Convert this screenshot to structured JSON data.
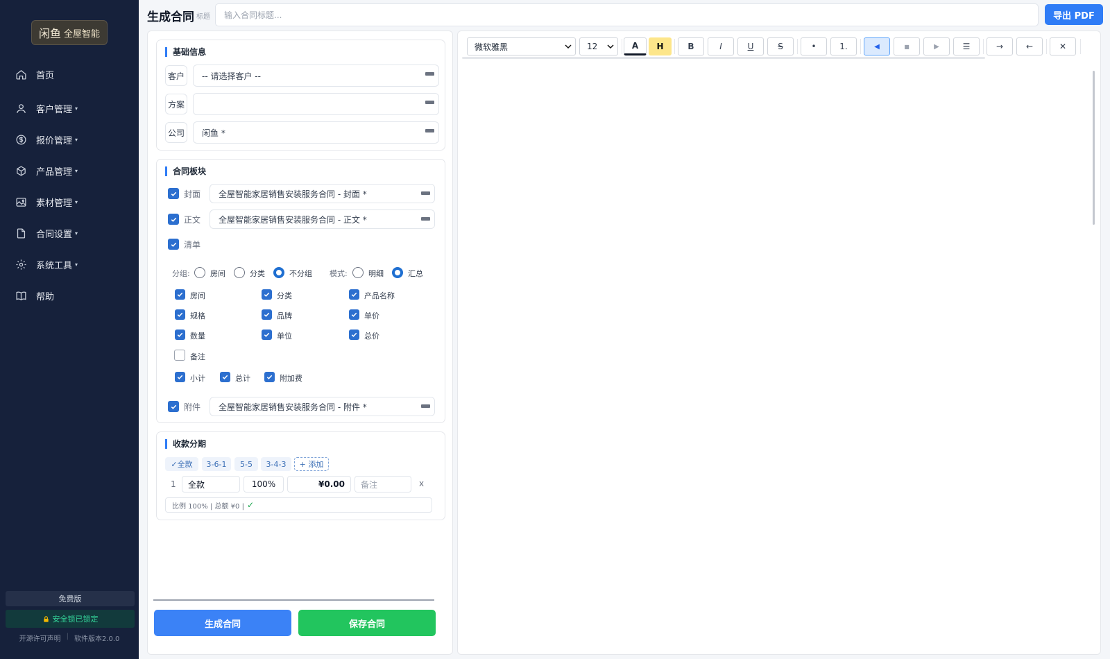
{
  "brand": {
    "seal": "闲鱼",
    "name": "全屋智能"
  },
  "nav": [
    {
      "label": "首页",
      "icon": "home-icon",
      "caret": false
    },
    {
      "label": "客户管理",
      "icon": "user-icon",
      "caret": true
    },
    {
      "label": "报价管理",
      "icon": "dollar-icon",
      "caret": true
    },
    {
      "label": "产品管理",
      "icon": "box-icon",
      "caret": true
    },
    {
      "label": "素材管理",
      "icon": "image-icon",
      "caret": true
    },
    {
      "label": "合同设置",
      "icon": "file-icon",
      "caret": true
    },
    {
      "label": "系统工具",
      "icon": "gear-icon",
      "caret": true
    },
    {
      "label": "帮助",
      "icon": "book-icon",
      "caret": false
    }
  ],
  "caret_glyph": "▾",
  "sidebar_footer": {
    "edition": "免费版",
    "lock_status": "安全锁已锁定",
    "license": "开源许可声明",
    "version": "软件版本2.0.0"
  },
  "header": {
    "title": "生成合同",
    "title_hint": "标题",
    "title_placeholder": "输入合同标题...",
    "export_label": "导出 PDF"
  },
  "basic": {
    "heading": "基础信息",
    "customer": {
      "label": "客户",
      "value": "-- 请选择客户 --"
    },
    "plan": {
      "label": "方案",
      "value": ""
    },
    "company": {
      "label": "公司",
      "value": "闲鱼 *"
    }
  },
  "blocks": {
    "heading": "合同板块",
    "cover": {
      "label": "封面",
      "checked": true,
      "value": "全屋智能家居销售安装服务合同 - 封面 *"
    },
    "body": {
      "label": "正文",
      "checked": true,
      "value": "全屋智能家居销售安装服务合同 - 正文 *"
    },
    "list": {
      "label": "清单",
      "checked": true
    },
    "group_label": "分组:",
    "group_options": [
      {
        "label": "房间",
        "selected": false
      },
      {
        "label": "分类",
        "selected": false
      },
      {
        "label": "不分组",
        "selected": true
      }
    ],
    "mode_label": "模式:",
    "mode_options": [
      {
        "label": "明细",
        "selected": false
      },
      {
        "label": "汇总",
        "selected": true
      }
    ],
    "columns": [
      {
        "label": "房间",
        "checked": true
      },
      {
        "label": "分类",
        "checked": true
      },
      {
        "label": "产品名称",
        "checked": true
      },
      {
        "label": "规格",
        "checked": true
      },
      {
        "label": "品牌",
        "checked": true
      },
      {
        "label": "单价",
        "checked": true
      },
      {
        "label": "数量",
        "checked": true
      },
      {
        "label": "单位",
        "checked": true
      },
      {
        "label": "总价",
        "checked": true
      },
      {
        "label": "备注",
        "checked": false
      }
    ],
    "totals": [
      {
        "label": "小计",
        "checked": true
      },
      {
        "label": "总计",
        "checked": true
      },
      {
        "label": "附加费",
        "checked": true
      }
    ],
    "attachment": {
      "label": "附件",
      "checked": true,
      "value": "全屋智能家居销售安装服务合同 - 附件 *"
    }
  },
  "payment": {
    "heading": "收款分期",
    "presets": [
      "✓全款",
      "3-6-1",
      "5-5",
      "3-4-3",
      "+ 添加"
    ],
    "rows": [
      {
        "index": "1",
        "name": "全款",
        "ratio": "100%",
        "amount": "¥0.00",
        "note_placeholder": "备注",
        "remove": "x"
      }
    ],
    "summary": "比例 100% | 总额 ¥0 |",
    "summary_ok": "✓"
  },
  "actions": {
    "generate": "生成合同",
    "save": "保存合同"
  },
  "toolbar": {
    "font": "微软雅黑",
    "size": "12",
    "color_btn": "A",
    "highlight_btn": "H",
    "bold": "B",
    "italic": "I",
    "underline": "U",
    "strike": "S",
    "bullet": "•",
    "ordered": "1.",
    "align_left": "◀",
    "align_center": "■",
    "align_right": "▶",
    "justify": "☰",
    "indent": "→",
    "outdent": "←",
    "clear": "✕"
  },
  "colors": {
    "accent": "#2f7cf6",
    "save": "#22c55e",
    "sidebar": "#16213b",
    "checkbox": "#2c6fcf",
    "highlight": "#fde68a"
  }
}
